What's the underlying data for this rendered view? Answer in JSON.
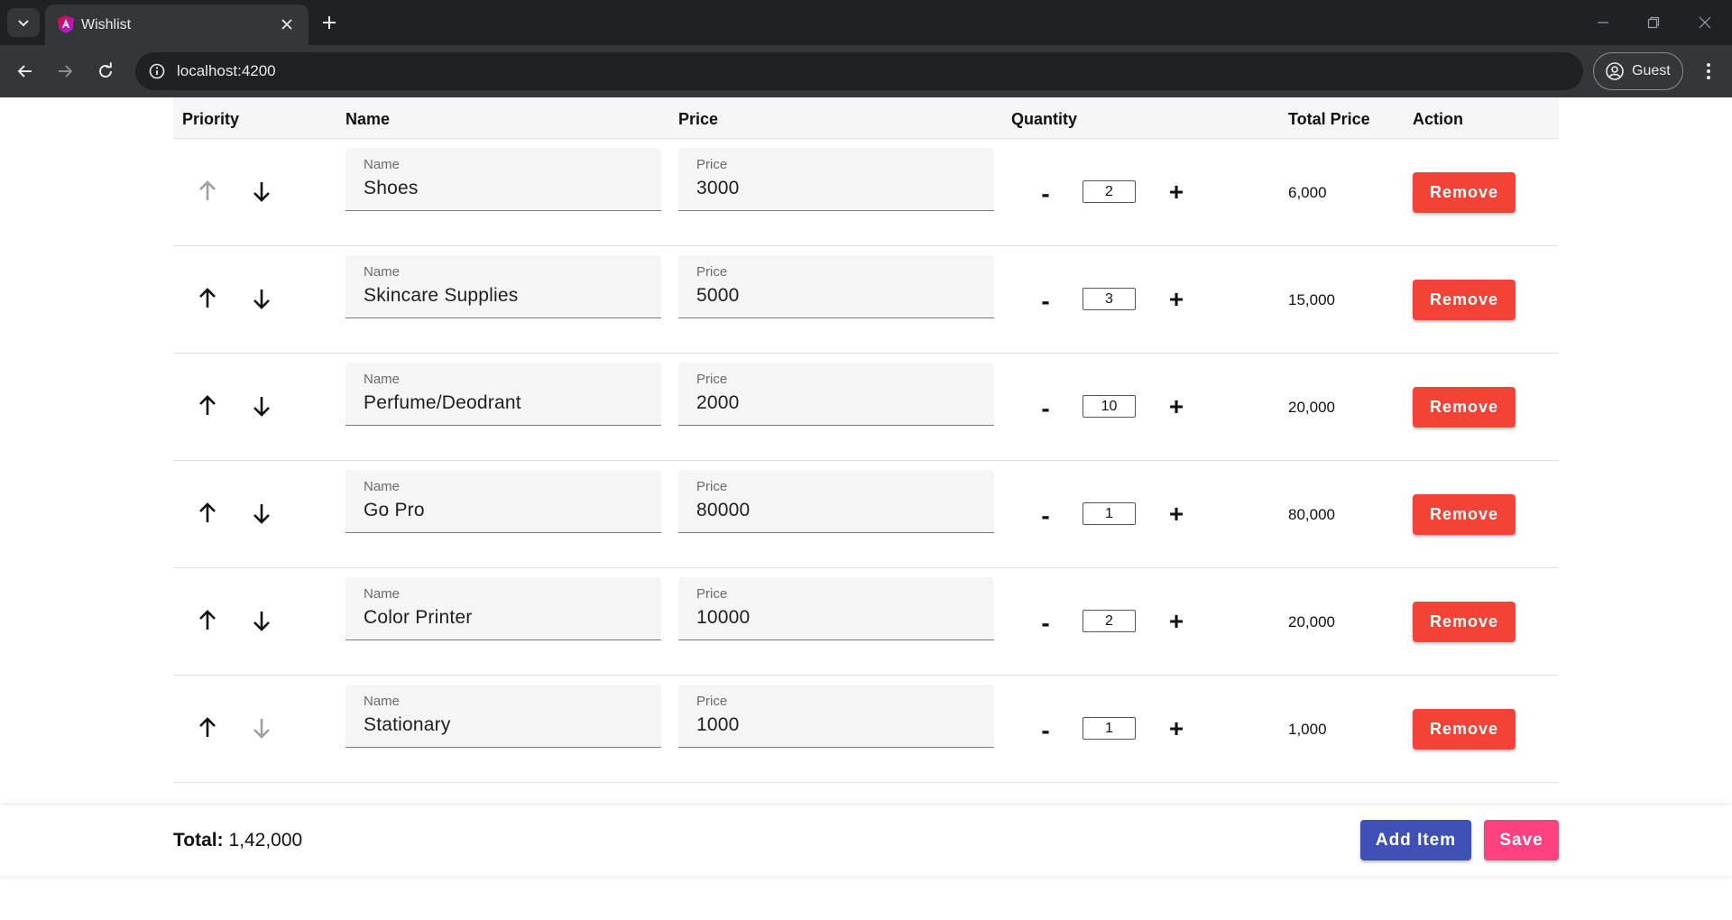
{
  "browser": {
    "tab_title": "Wishlist",
    "url": "localhost:4200",
    "profile_label": "Guest",
    "icons": {
      "tab_search": "chevron-down-icon",
      "close_tab": "close-icon",
      "new_tab": "plus-icon",
      "back": "arrow-left-icon",
      "forward": "arrow-right-icon",
      "reload": "reload-icon",
      "site_info": "info-icon",
      "profile": "account-circle-icon",
      "menu": "kebab-menu-icon"
    }
  },
  "table": {
    "headers": {
      "priority": "Priority",
      "name": "Name",
      "price": "Price",
      "quantity": "Quantity",
      "total": "Total Price",
      "action": "Action"
    },
    "field_labels": {
      "name": "Name",
      "price": "Price"
    },
    "minus_label": "-",
    "plus_label": "+",
    "remove_label": "Remove",
    "rows": [
      {
        "name": "Shoes",
        "price": "3000",
        "quantity": "2",
        "total": "6,000",
        "up_enabled": false,
        "down_enabled": true
      },
      {
        "name": "Skincare Supplies",
        "price": "5000",
        "quantity": "3",
        "total": "15,000",
        "up_enabled": true,
        "down_enabled": true
      },
      {
        "name": "Perfume/Deodrant",
        "price": "2000",
        "quantity": "10",
        "total": "20,000",
        "up_enabled": true,
        "down_enabled": true
      },
      {
        "name": "Go Pro",
        "price": "80000",
        "quantity": "1",
        "total": "80,000",
        "up_enabled": true,
        "down_enabled": true
      },
      {
        "name": "Color Printer",
        "price": "10000",
        "quantity": "2",
        "total": "20,000",
        "up_enabled": true,
        "down_enabled": true
      },
      {
        "name": "Stationary",
        "price": "1000",
        "quantity": "1",
        "total": "1,000",
        "up_enabled": true,
        "down_enabled": false
      }
    ]
  },
  "footer": {
    "total_label": "Total:",
    "total_value": "1,42,000",
    "add_label": "Add Item",
    "save_label": "Save"
  },
  "colors": {
    "remove": "#f44336",
    "add": "#3f51b5",
    "save": "#ff4081",
    "arrow_enabled": "#111111",
    "arrow_disabled": "#a0a0a0"
  }
}
